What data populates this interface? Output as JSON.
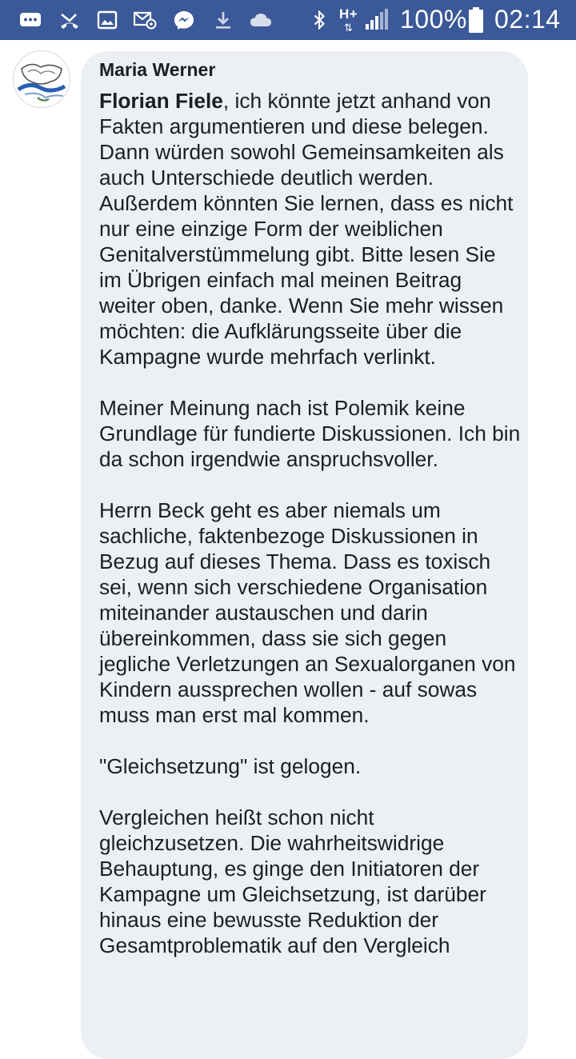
{
  "status_bar": {
    "battery": "100%",
    "time": "02:14",
    "network": "H+",
    "icons": [
      "messages-icon",
      "missed-call-icon",
      "gallery-icon",
      "email-icon",
      "messenger-icon",
      "download-icon",
      "cloud-icon",
      "bluetooth-icon",
      "signal-icon",
      "battery-icon"
    ]
  },
  "comment": {
    "author": "Maria Werner",
    "mention": "Florian Fiele",
    "para1_rest": ", ich könnte jetzt anhand von Fakten argumentieren und diese belegen. Dann würden sowohl Gemeinsamkeiten als auch Unterschiede deutlich werden. Außerdem könnten Sie lernen, dass es nicht nur eine einzige Form der weiblichen Genitalverstümmelung gibt. Bitte lesen Sie im Übrigen einfach mal meinen Beitrag weiter oben, danke. Wenn Sie mehr wissen möchten: die Aufklärungsseite über die Kampagne wurde mehrfach verlinkt.",
    "para2": "Meiner Meinung nach ist Polemik keine Grundlage für fundierte Diskussionen. Ich bin da schon irgendwie anspruchsvoller.",
    "para3": "Herrn Beck geht es aber niemals um sachliche, faktenbezoge Diskussionen in Bezug auf dieses Thema. Dass es toxisch sei, wenn sich verschiedene Organisation miteinander austauschen und darin übereinkommen, dass sie sich gegen jegliche Verletzungen an Sexualorganen von Kindern aussprechen wollen - auf sowas muss man erst mal kommen.",
    "para4": "\"Gleichsetzung\" ist gelogen.",
    "para5": "Vergleichen heißt schon nicht gleichzusetzen. Die wahrheitswidrige Behauptung, es ginge den Initiatoren der Kampagne um Gleichsetzung, ist darüber hinaus eine bewusste Reduktion der Gesamtproblematik auf den Vergleich"
  }
}
